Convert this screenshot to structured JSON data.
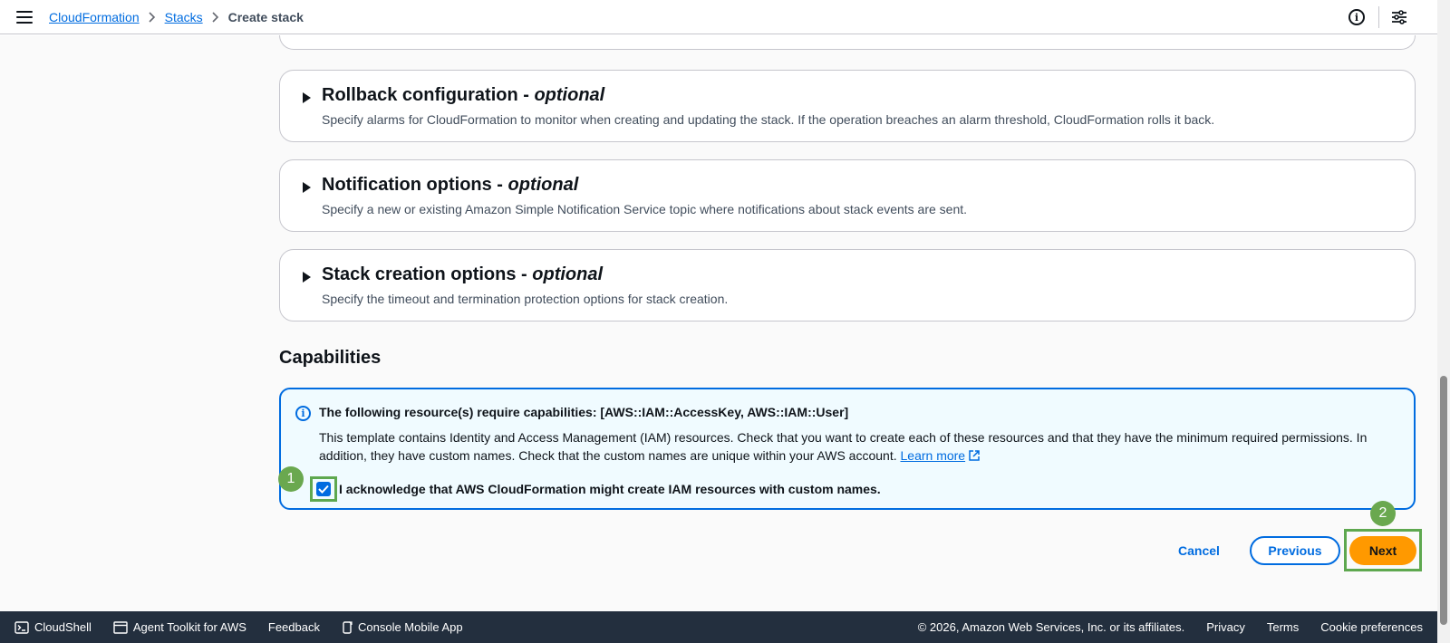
{
  "breadcrumb": {
    "root": "CloudFormation",
    "stacks": "Stacks",
    "current": "Create stack"
  },
  "panels": {
    "top_partial_text": "",
    "rollback": {
      "title": "Rollback configuration - ",
      "optional": "optional",
      "description": "Specify alarms for CloudFormation to monitor when creating and updating the stack. If the operation breaches an alarm threshold, CloudFormation rolls it back."
    },
    "notification": {
      "title": "Notification options - ",
      "optional": "optional",
      "description": "Specify a new or existing Amazon Simple Notification Service topic where notifications about stack events are sent."
    },
    "creation": {
      "title": "Stack creation options - ",
      "optional": "optional",
      "description": "Specify the timeout and termination protection options for stack creation."
    }
  },
  "capabilities": {
    "heading": "Capabilities",
    "alert_title": "The following resource(s) require capabilities: [AWS::IAM::AccessKey, AWS::IAM::User]",
    "alert_body": "This template contains Identity and Access Management (IAM) resources. Check that you want to create each of these resources and that they have the minimum required permissions. In addition, they have custom names. Check that the custom names are unique within your AWS account.",
    "learn_more": "Learn more",
    "acknowledge_label": "I acknowledge that AWS CloudFormation might create IAM resources with custom names.",
    "acknowledged": true
  },
  "steps": {
    "one": "1",
    "two": "2"
  },
  "actions": {
    "cancel": "Cancel",
    "previous": "Previous",
    "next": "Next"
  },
  "footer": {
    "cloudshell": "CloudShell",
    "agent_toolkit": "Agent Toolkit for AWS",
    "feedback": "Feedback",
    "mobile_app": "Console Mobile App",
    "copyright": "© 2026, Amazon Web Services, Inc. or its affiliates.",
    "privacy": "Privacy",
    "terms": "Terms",
    "cookies": "Cookie preferences"
  },
  "colors": {
    "link": "#006ce0",
    "primary_button": "#ff9900",
    "highlight": "#5ea84f",
    "footer_bg": "#232f3e"
  }
}
